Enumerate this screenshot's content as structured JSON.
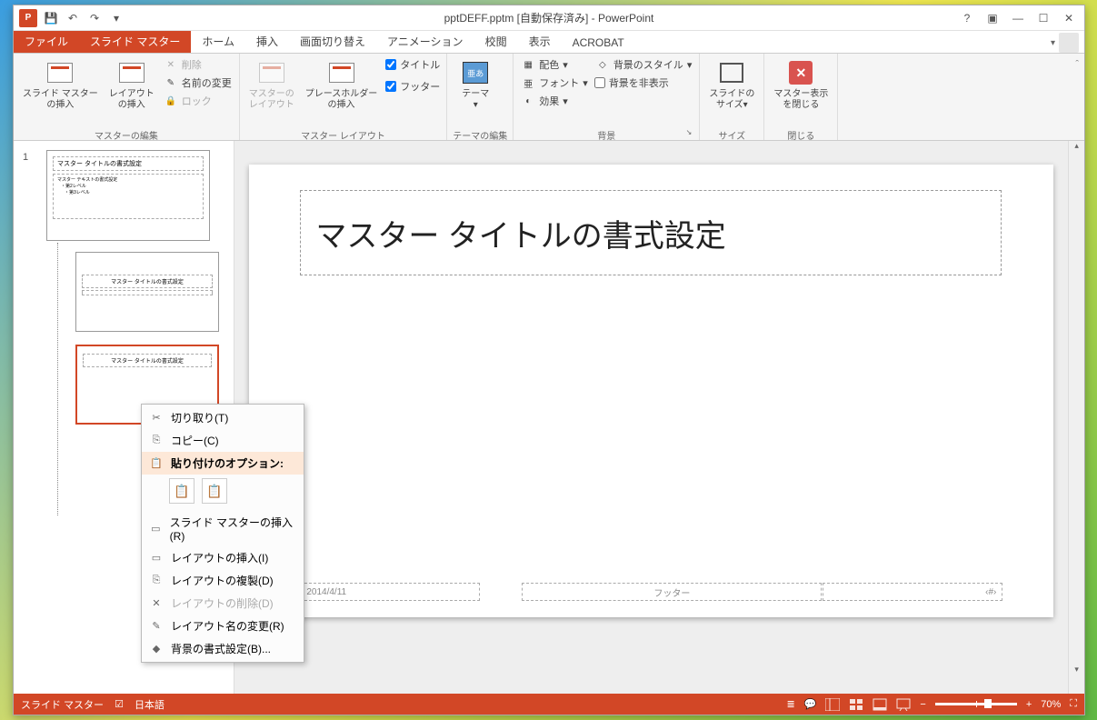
{
  "title": "pptDEFF.pptm [自動保存済み] - PowerPoint",
  "tabs": {
    "file": "ファイル",
    "slideMaster": "スライド マスター",
    "home": "ホーム",
    "insert": "挿入",
    "transitions": "画面切り替え",
    "animations": "アニメーション",
    "review": "校閲",
    "view": "表示",
    "acrobat": "ACROBAT"
  },
  "ribbon": {
    "insertSlideMaster": "スライド マスター\nの挿入",
    "insertLayout": "レイアウト\nの挿入",
    "delete": "削除",
    "rename": "名前の変更",
    "lock": "ロック",
    "editMasterGroup": "マスターの編集",
    "masterLayout": "マスターの\nレイアウト",
    "insertPlaceholder": "プレースホルダー\nの挿入",
    "titleChk": "タイトル",
    "footerChk": "フッター",
    "masterLayoutGroup": "マスター レイアウト",
    "theme": "テーマ",
    "themeText": "亜あ",
    "editThemeGroup": "テーマの編集",
    "colors": "配色",
    "fonts": "フォント",
    "effects": "効果",
    "bgStyles": "背景のスタイル",
    "hideBg": "背景を非表示",
    "bgGroup": "背景",
    "slideSize": "スライドの\nサイズ",
    "sizeGroup": "サイズ",
    "closeMaster": "マスター表示\nを閉じる",
    "closeGroup": "閉じる"
  },
  "thumbs": {
    "slideNum": "1",
    "masterTitle": "マスター タイトルの書式設定",
    "masterText": "マスター テキストの書式設定",
    "layout1Title": "マスター タイトルの書式設定",
    "layout2Title": "マスター タイトルの書式設定"
  },
  "slide": {
    "titlePh": "マスター タイトルの書式設定",
    "date": "2014/4/11",
    "footer": "フッター",
    "num": "‹#›"
  },
  "contextMenu": {
    "cut": "切り取り(T)",
    "copy": "コピー(C)",
    "pasteOptions": "貼り付けのオプション:",
    "insertSlideMaster": "スライド マスターの挿入(R)",
    "insertLayout": "レイアウトの挿入(I)",
    "duplicateLayout": "レイアウトの複製(D)",
    "deleteLayout": "レイアウトの削除(D)",
    "renameLayout": "レイアウト名の変更(R)",
    "formatBg": "背景の書式設定(B)..."
  },
  "status": {
    "mode": "スライド マスター",
    "lang": "日本語",
    "zoom": "70%"
  }
}
